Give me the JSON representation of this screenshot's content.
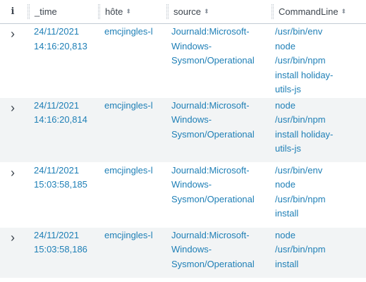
{
  "columns": {
    "info": "i",
    "time": "_time",
    "host": "hôte",
    "source": "source",
    "commandline": "CommandLine"
  },
  "icons": {
    "sort": "sort-icon",
    "expand": "chevron-right-icon",
    "info": "info-icon"
  },
  "colors": {
    "link": "#1e7fb6",
    "row_alt": "#f2f4f5",
    "header_text": "#3c444d"
  },
  "rows": [
    {
      "time_date": "24/11/2021",
      "time_clock": "14:16:20,813",
      "host": "emcjingles-l",
      "source": "Journald:Microsoft-Windows-Sysmon/Operational",
      "source_lines": [
        "Journald:Microsoft-",
        "Windows-",
        "Sysmon/Operational"
      ],
      "cmd_lines": [
        "/usr/bin/env",
        "node",
        "/usr/bin/npm",
        "install holiday-",
        "utils-js"
      ]
    },
    {
      "time_date": "24/11/2021",
      "time_clock": "14:16:20,814",
      "host": "emcjingles-l",
      "source": "Journald:Microsoft-Windows-Sysmon/Operational",
      "source_lines": [
        "Journald:Microsoft-",
        "Windows-",
        "Sysmon/Operational"
      ],
      "cmd_lines": [
        "node",
        "/usr/bin/npm",
        "install holiday-",
        "utils-js"
      ]
    },
    {
      "time_date": "24/11/2021",
      "time_clock": "15:03:58,185",
      "host": "emcjingles-l",
      "source": "Journald:Microsoft-Windows-Sysmon/Operational",
      "source_lines": [
        "Journald:Microsoft-",
        "Windows-",
        "Sysmon/Operational"
      ],
      "cmd_lines": [
        "/usr/bin/env",
        "node",
        "/usr/bin/npm",
        "install"
      ]
    },
    {
      "time_date": "24/11/2021",
      "time_clock": "15:03:58,186",
      "host": "emcjingles-l",
      "source": "Journald:Microsoft-Windows-Sysmon/Operational",
      "source_lines": [
        "Journald:Microsoft-",
        "Windows-",
        "Sysmon/Operational"
      ],
      "cmd_lines": [
        "node",
        "/usr/bin/npm",
        "install"
      ]
    }
  ]
}
